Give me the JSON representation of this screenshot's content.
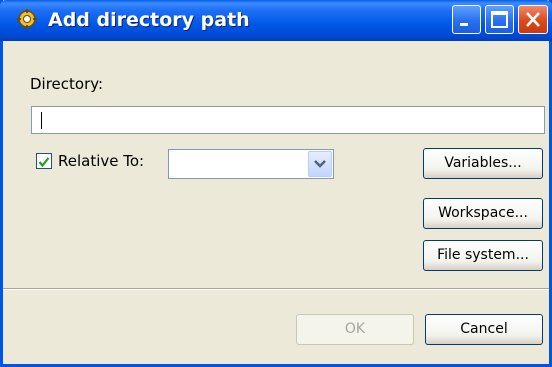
{
  "window": {
    "title": "Add directory path",
    "controls": [
      "minimize-icon",
      "maximize-icon",
      "close-icon"
    ]
  },
  "form": {
    "directory_label": "Directory:",
    "directory_value": "",
    "relative_checkbox_label": "Relative To:",
    "relative_checked": true,
    "relative_to_value": ""
  },
  "buttons": {
    "variables": "Variables...",
    "workspace": "Workspace...",
    "file_system": "File system...",
    "ok": "OK",
    "cancel": "Cancel"
  },
  "colors": {
    "titlebar": "#0058e8",
    "dialog_bg": "#ece9d8",
    "button_border": "#003c74",
    "disabled_text": "#a7a69a",
    "check_mark": "#21a121"
  }
}
